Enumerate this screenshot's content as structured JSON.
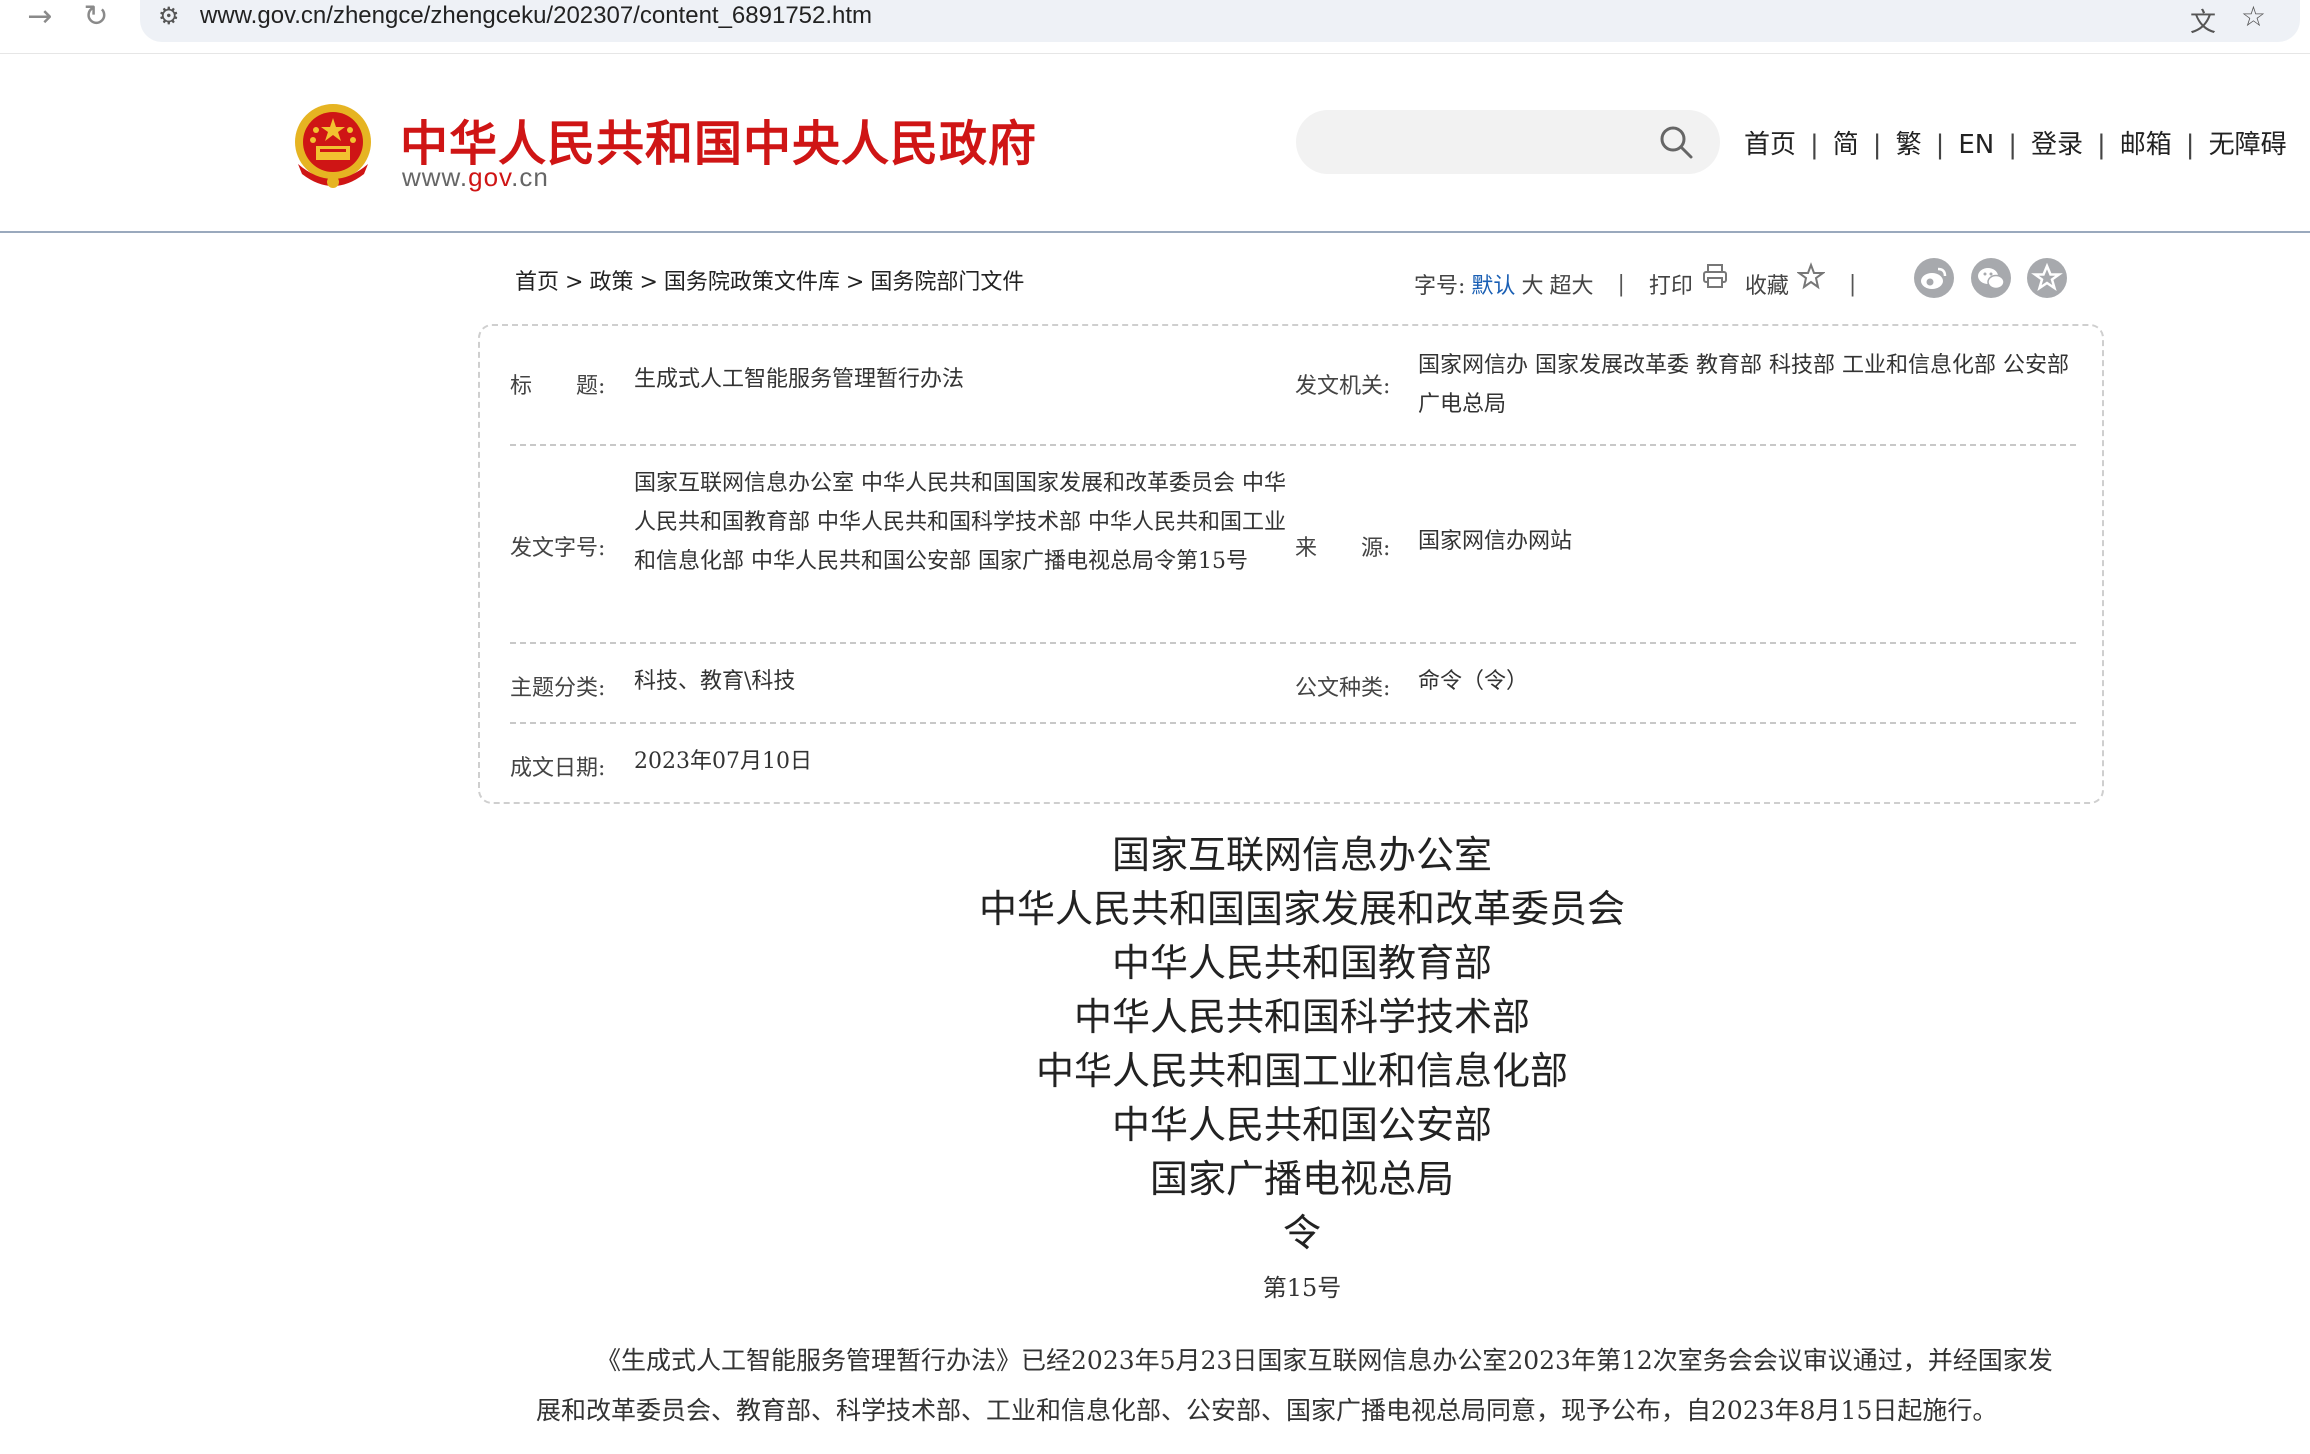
{
  "browser": {
    "url": "www.gov.cn/zhengce/zhengceku/202307/content_6891752.htm",
    "forward_icon": "→",
    "reload_icon": "↻",
    "site_info_icon": "⚙",
    "translate_icon": "文",
    "bookmark_icon": "☆"
  },
  "header": {
    "site_title": "中华人民共和国中央人民政府",
    "domain_prefix": "www.",
    "domain_highlight": "gov",
    "domain_suffix": ".cn",
    "search_placeholder": "",
    "links": [
      "首页",
      "简",
      "繁",
      "EN",
      "登录",
      "邮箱",
      "无障碍"
    ],
    "separator": "|",
    "brand_color": "#cf1515"
  },
  "breadcrumb": [
    "首页",
    "政策",
    "国务院政策文件库",
    "国务院部门文件"
  ],
  "breadcrumb_separator": ">",
  "tools": {
    "font_size_label": "字号:",
    "font_default": "默认",
    "font_large": "大",
    "font_xlarge": "超大",
    "separator": "|",
    "print": "打印",
    "favorite": "收藏",
    "share": [
      "weibo-icon",
      "wechat-icon",
      "favorite-icon"
    ]
  },
  "meta": {
    "title_label": "标　　题:",
    "title_value": "生成式人工智能服务管理暂行办法",
    "issuer_label": "发文机关:",
    "issuer_value": "国家网信办 国家发展改革委 教育部 科技部 工业和信息化部 公安部 广电总局",
    "doc_no_label": "发文字号:",
    "doc_no_value": "国家互联网信息办公室 中华人民共和国国家发展和改革委员会 中华人民共和国教育部 中华人民共和国科学技术部 中华人民共和国工业和信息化部 中华人民共和国公安部 国家广播电视总局令第15号",
    "source_label": "来　　源:",
    "source_value": "国家网信办网站",
    "topic_label": "主题分类:",
    "topic_value": "科技、教育\\科技",
    "doc_type_label": "公文种类:",
    "doc_type_value": "命令（令）",
    "date_label": "成文日期:",
    "date_value": "2023年07月10日"
  },
  "document": {
    "issuers": [
      "国家互联网信息办公室",
      "中华人民共和国国家发展和改革委员会",
      "中华人民共和国教育部",
      "中华人民共和国科学技术部",
      "中华人民共和国工业和信息化部",
      "中华人民共和国公安部",
      "国家广播电视总局",
      "令"
    ],
    "order_number": "第15号",
    "paragraph": "《生成式人工智能服务管理暂行办法》已经2023年5月23日国家互联网信息办公室2023年第12次室务会会议审议通过，并经国家发展和改革委员会、教育部、科学技术部、工业和信息化部、公安部、国家广播电视总局同意，现予公布，自2023年8月15日起施行。"
  }
}
